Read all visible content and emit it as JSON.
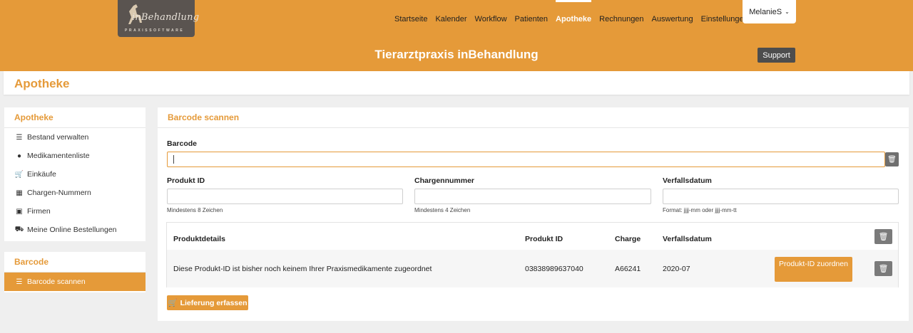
{
  "header": {
    "logo_text": "inBehandlung",
    "logo_sub": "PRAXISSOFTWARE",
    "nav": [
      "Startseite",
      "Kalender",
      "Workflow",
      "Patienten",
      "Apotheke",
      "Rechnungen",
      "Auswertung",
      "Einstellungen"
    ],
    "active_nav": "Apotheke",
    "user": "MelanieS",
    "title": "Tierarztpraxis inBehandlung",
    "support": "Support"
  },
  "page_title": "Apotheke",
  "sidebar": {
    "section1_title": "Apotheke",
    "items": [
      {
        "label": "Bestand verwalten",
        "icon": "list-icon"
      },
      {
        "label": "Medikamentenliste",
        "icon": "pills-icon"
      },
      {
        "label": "Einkäufe",
        "icon": "cart-icon"
      },
      {
        "label": "Chargen-Nummern",
        "icon": "boxes-icon"
      },
      {
        "label": "Firmen",
        "icon": "building-icon"
      },
      {
        "label": "Meine Online Bestellungen",
        "icon": "truck-icon"
      }
    ],
    "section2_title": "Barcode",
    "items2": [
      {
        "label": "Barcode scannen",
        "icon": "barcode-icon"
      }
    ]
  },
  "main": {
    "title": "Barcode scannen",
    "barcode_label": "Barcode",
    "barcode_value": "",
    "produkt_id_label": "Produkt ID",
    "produkt_id_hint": "Mindestens 8 Zeichen",
    "charge_label": "Chargennummer",
    "charge_hint": "Mindestens 4 Zeichen",
    "verfall_label": "Verfallsdatum",
    "verfall_hint": "Format: jjjj-mm oder jjjj-mm-tt"
  },
  "table": {
    "headers": [
      "Produktdetails",
      "Produkt ID",
      "Charge",
      "Verfallsdatum"
    ],
    "rows": [
      {
        "details": "Diese Produkt-ID ist bisher noch keinem Ihrer Praxismedikamente zugeordnet",
        "produkt_id": "03838989637040",
        "charge": "A66241",
        "verfall": "2020-07",
        "button": "Produkt-ID zuordnen"
      }
    ]
  },
  "deliver_button": "Lieferung erfassen",
  "colors": {
    "accent": "#e59a39",
    "dark": "#4d4d4d"
  }
}
